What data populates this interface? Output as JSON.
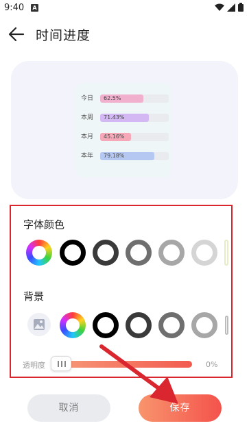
{
  "status": {
    "time": "9:40",
    "notif": "A"
  },
  "header": {
    "title": "时间进度"
  },
  "preview": {
    "rows": [
      {
        "label": "今日",
        "value": "62.5%",
        "progress": 0.625,
        "color": "#f2b0cf"
      },
      {
        "label": "本周",
        "value": "71.43%",
        "progress": 0.7143,
        "color": "#d3b8f4"
      },
      {
        "label": "本月",
        "value": "45.16%",
        "progress": 0.4516,
        "color": "#f6a8b8"
      },
      {
        "label": "本年",
        "value": "79.18%",
        "progress": 0.7918,
        "color": "#b5c8f1"
      }
    ]
  },
  "font_color": {
    "label": "字体颜色",
    "swatches": [
      "rainbow",
      "#000000",
      "#3a3a3a",
      "#6f6f6f",
      "#a7a7a7",
      "#d5d5d5"
    ]
  },
  "background": {
    "label": "背景",
    "swatches": [
      "image",
      "rainbow",
      "#000000",
      "#3a3a3a",
      "#6f6f6f",
      "#a7a7a7"
    ]
  },
  "opacity": {
    "label": "透明度",
    "value": "0%",
    "level": 0
  },
  "buttons": {
    "cancel": "取消",
    "save": "保存"
  },
  "colors": {
    "highlight_border": "#d9262f",
    "accent": "#f4534c"
  }
}
